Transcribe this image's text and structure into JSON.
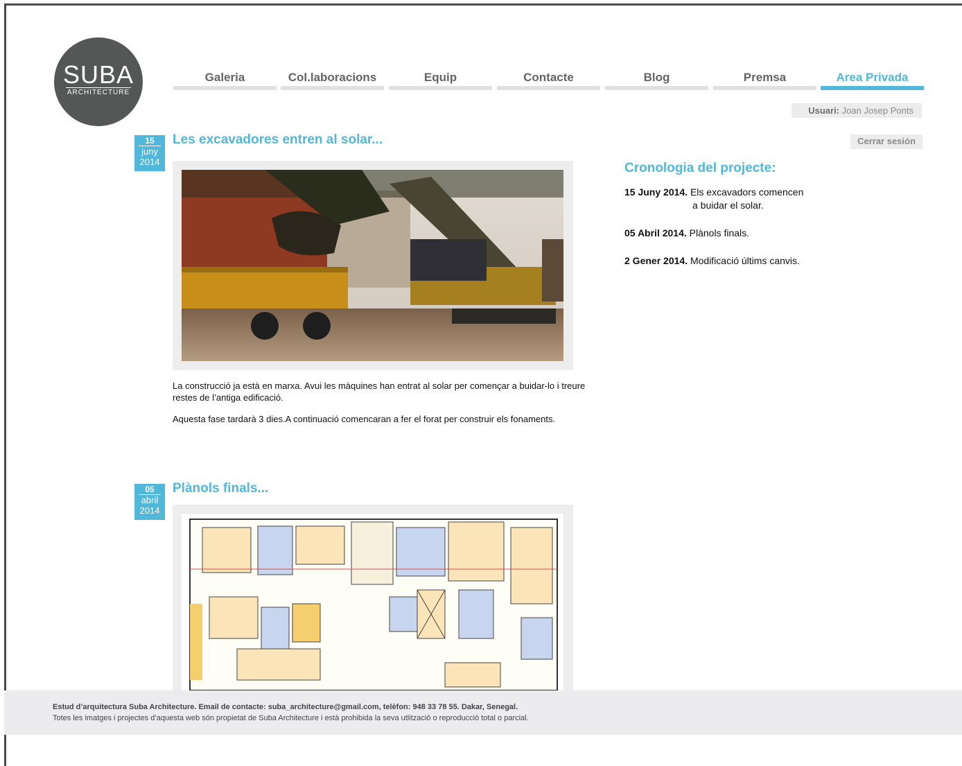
{
  "brand": {
    "name": "SUBA",
    "tagline": "ARCHITECTURE"
  },
  "nav": {
    "items": [
      {
        "label": "Galeria"
      },
      {
        "label": "Col.laboracions"
      },
      {
        "label": "Equip"
      },
      {
        "label": "Contacte"
      },
      {
        "label": "Blog"
      },
      {
        "label": "Premsa"
      },
      {
        "label": "Area Privada",
        "active": true
      }
    ]
  },
  "user": {
    "label": "Usuari:",
    "name": "Joan Josep Ponts",
    "logout_label": "Cerrar sesión"
  },
  "posts": [
    {
      "day": "15",
      "month": "juny",
      "year": "2014",
      "title": "Les excavadores entren al solar...",
      "paragraphs": [
        "La construcció ja està en marxa. Avui les màquines han entrat al solar per començar a buidar-lo i treure restes de l’antiga edificació.",
        "Aquesta fase tardarà 3 dies.A continuació comencaran a fer el forat per construir els fonaments."
      ]
    },
    {
      "day": "05",
      "month": "abril",
      "year": "2014",
      "title": "Plànols finals..."
    }
  ],
  "timeline": {
    "title": "Cronologia del projecte:",
    "entries": [
      {
        "date": "15 Juny 2014.",
        "text": "Els excavadors comencen",
        "cont": "a buidar el solar."
      },
      {
        "date": "05 Abril 2014.",
        "text": "Plànols finals."
      },
      {
        "date": "2 Gener 2014.",
        "text": "Modificació últims canvis."
      }
    ]
  },
  "footer": {
    "line1": "Estud d’arquitectura Suba Architecture. Email de contacte: suba_architecture@gmail.com, telèfon: 948 33 78 55. Dakar, Senegal.",
    "line2": "Totes les imatges i projectes d’aquesta web són propietat de Suba Architecture i està prohibida la seva utlització o reproducció total o parcial."
  },
  "colors": {
    "accent": "#51b8d9",
    "logo_bg": "#555756",
    "nav_bar": "#e1e1e3"
  }
}
